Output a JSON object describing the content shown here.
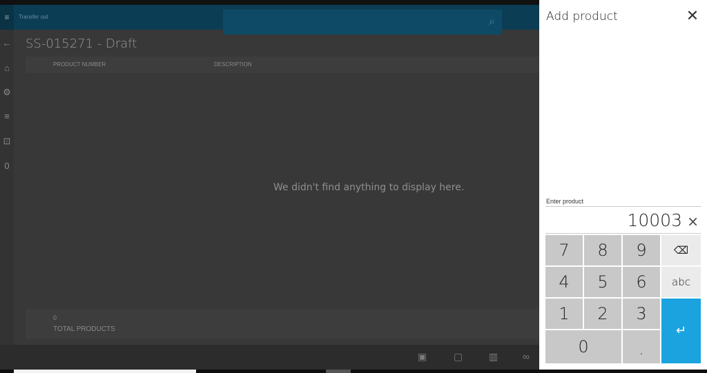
{
  "app": {
    "title": "Transfer out",
    "page_title": "SS-015271 - Draft",
    "columns": [
      "PRODUCT NUMBER",
      "DESCRIPTION"
    ],
    "empty_message": "We didn't find anything to display here.",
    "total_count": "0",
    "total_label": "TOTAL PRODUCTS"
  },
  "rail_icons": [
    "menu-icon",
    "back-icon",
    "home-icon",
    "products-icon",
    "list-icon",
    "bag-icon",
    "zero-badge"
  ],
  "rail_glyphs": [
    "←",
    "⌂",
    "⚙",
    "≡",
    "⊡",
    "0"
  ],
  "panel": {
    "title": "Add product",
    "close_glyph": "✕",
    "entry_label": "Enter product",
    "entry_value": "10003",
    "clear_glyph": "×"
  },
  "keypad": {
    "keys": [
      "7",
      "8",
      "9",
      "⌫",
      "4",
      "5",
      "6",
      "abc",
      "1",
      "2",
      "3",
      "↵",
      "0",
      "."
    ]
  },
  "colors": {
    "accent": "#1aa3df",
    "topbar": "#0b3e55"
  }
}
